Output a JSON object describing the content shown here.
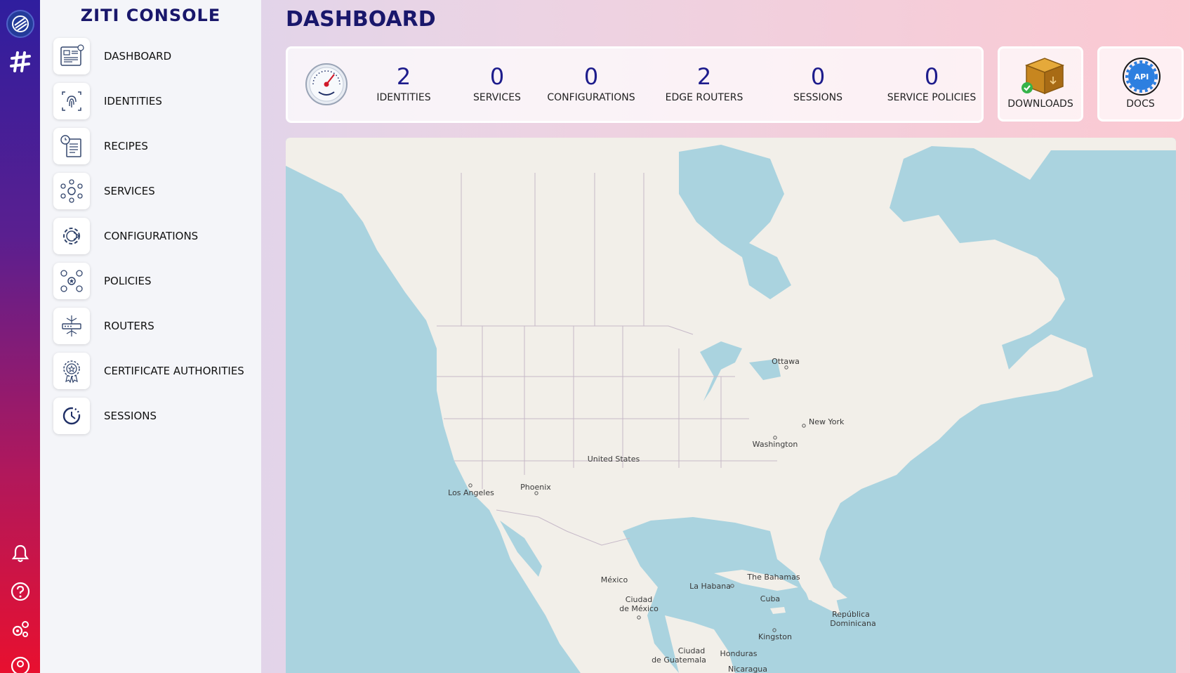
{
  "app": {
    "title": "ZITI CONSOLE"
  },
  "nav": [
    {
      "label": "DASHBOARD",
      "icon": "dashboard-icon"
    },
    {
      "label": "IDENTITIES",
      "icon": "fingerprint-icon"
    },
    {
      "label": "RECIPES",
      "icon": "recipe-icon"
    },
    {
      "label": "SERVICES",
      "icon": "services-icon"
    },
    {
      "label": "CONFIGURATIONS",
      "icon": "configurations-icon"
    },
    {
      "label": "POLICIES",
      "icon": "policies-icon"
    },
    {
      "label": "ROUTERS",
      "icon": "routers-icon"
    },
    {
      "label": "CERTIFICATE AUTHORITIES",
      "icon": "certificate-icon"
    },
    {
      "label": "SESSIONS",
      "icon": "sessions-icon"
    }
  ],
  "page": {
    "title": "DASHBOARD"
  },
  "stats": [
    {
      "value": "2",
      "label": "IDENTITIES"
    },
    {
      "value": "0",
      "label": "SERVICES"
    },
    {
      "value": "0",
      "label": "CONFIGURATIONS"
    },
    {
      "value": "2",
      "label": "EDGE ROUTERS"
    },
    {
      "value": "0",
      "label": "SESSIONS"
    },
    {
      "value": "0",
      "label": "SERVICE POLICIES"
    }
  ],
  "tiles": {
    "downloads": "DOWNLOADS",
    "docs": "DOCS",
    "docs_badge": "API"
  },
  "map_labels": {
    "ottawa": "Ottawa",
    "new_york": "New York",
    "washington": "Washington",
    "united_states": "United States",
    "phoenix": "Phoenix",
    "los_angeles": "Los Angeles",
    "mexico": "México",
    "ciudad_de_mexico_1": "Ciudad",
    "ciudad_de_mexico_2": "de México",
    "la_habana": "La Habana",
    "the_bahamas": "The Bahamas",
    "cuba": "Cuba",
    "republica_1": "República",
    "republica_2": "Dominicana",
    "kingston": "Kingston",
    "guatemala_1": "Ciudad",
    "guatemala_2": "de Guatemala",
    "honduras": "Honduras",
    "nicaragua": "Nicaragua"
  },
  "colors": {
    "brand": "#19176b",
    "stat_number": "#1d1c8c",
    "water": "#aad3df",
    "land": "#f2efe9"
  }
}
